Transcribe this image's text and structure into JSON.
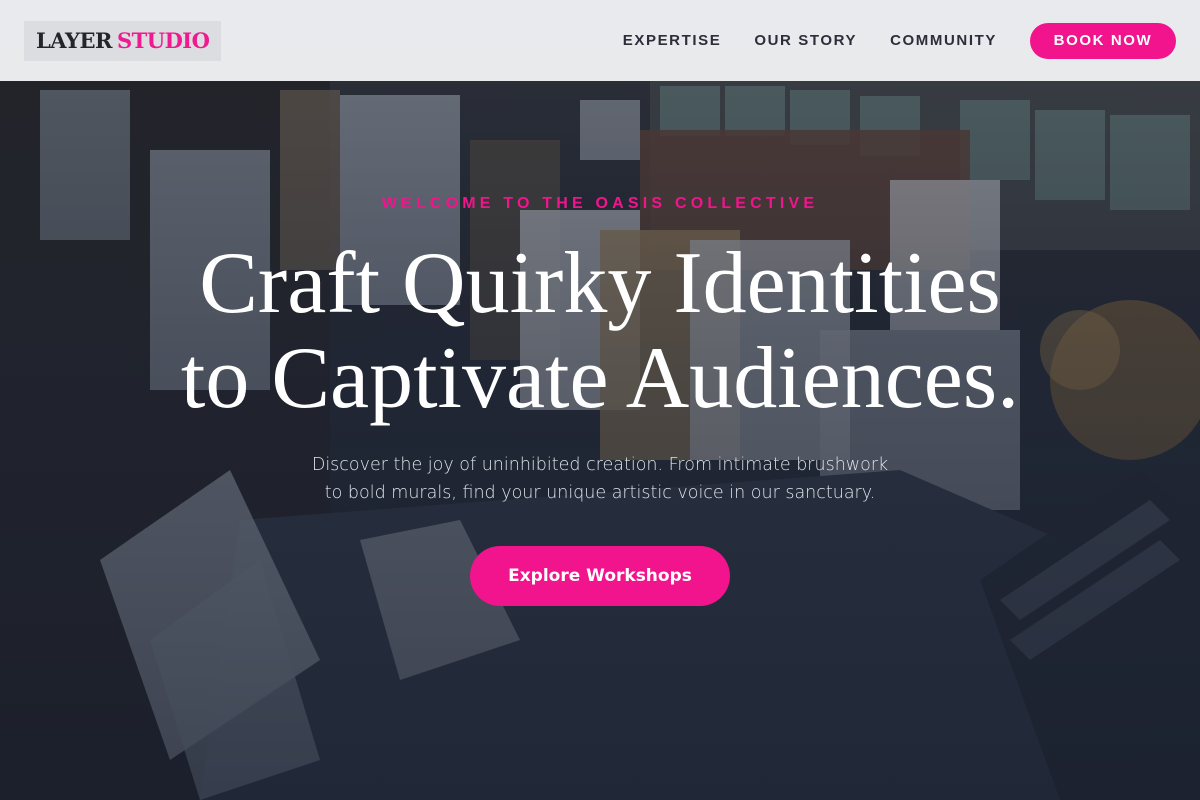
{
  "nav": {
    "logo_primary": "LAYER",
    "logo_accent": "STUDIO",
    "links": [
      {
        "label": "EXPERTISE"
      },
      {
        "label": "OUR STORY"
      },
      {
        "label": "COMMUNITY"
      }
    ],
    "book_label": "BOOK NOW"
  },
  "hero": {
    "eyebrow": "WELCOME TO THE OASIS COLLECTIVE",
    "headline_line1": "Craft Quirky Identities",
    "headline_line2": "to Captivate Audiences.",
    "subtext_line1": "Discover the joy of uninhibited creation. From intimate brushwork",
    "subtext_line2": "to bold murals, find your unique artistic voice in our sanctuary.",
    "cta_label": "Explore Workshops",
    "background_image": "art-studio-photo"
  },
  "colors": {
    "accent": "#f2148c",
    "nav_bg": "#f0f1f3",
    "nav_text": "#2b2f3a",
    "headline": "#ffffff"
  }
}
